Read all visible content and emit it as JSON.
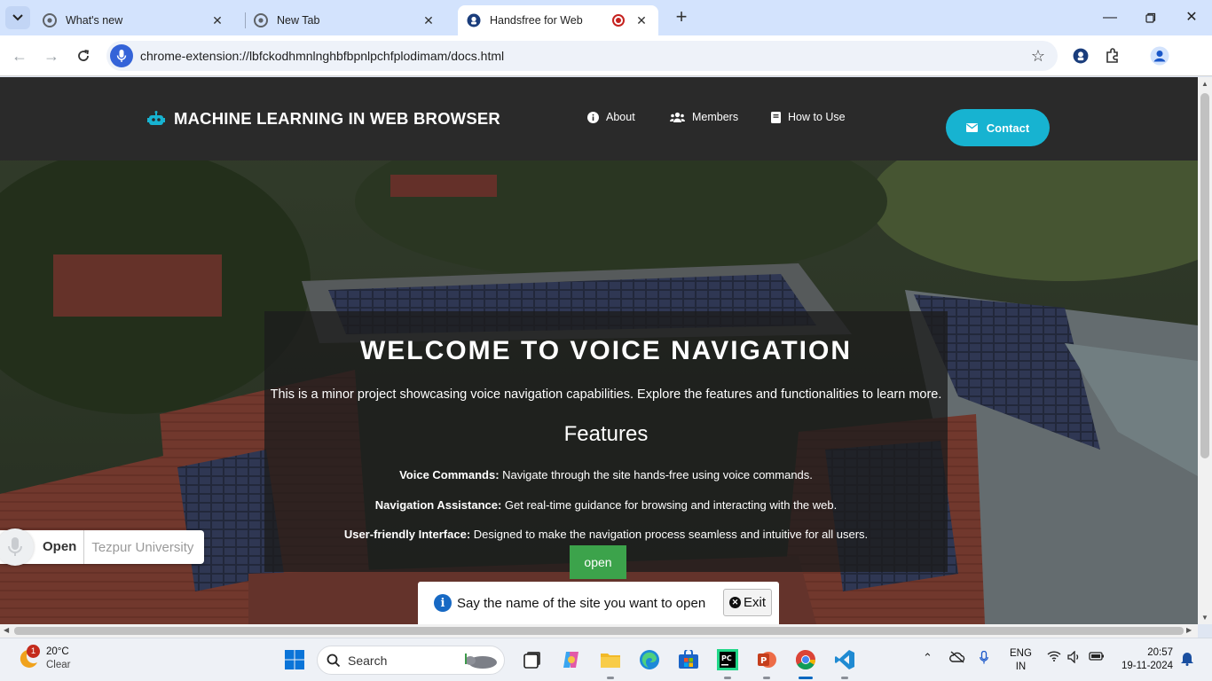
{
  "browser": {
    "tabs": [
      {
        "title": "What's new",
        "active": false
      },
      {
        "title": "New Tab",
        "active": false
      },
      {
        "title": "Handsfree for Web",
        "active": true
      }
    ],
    "url": "chrome-extension://lbfckodhmnlnghbfbpnlpchfplodimam/docs.html"
  },
  "site": {
    "brand": "MACHINE LEARNING IN WEB BROWSER",
    "nav": [
      {
        "label": "About",
        "icon": "info-icon"
      },
      {
        "label": "Members",
        "icon": "users-icon"
      },
      {
        "label": "How to Use",
        "icon": "book-icon"
      }
    ],
    "contact_label": "Contact",
    "hero": {
      "title": "WELCOME TO VOICE NAVIGATION",
      "description": "This is a minor project showcasing voice navigation capabilities. Explore the features and functionalities to learn more.",
      "features_heading": "Features",
      "features": [
        {
          "name": "Voice Commands:",
          "text": " Navigate through the site hands-free using voice commands."
        },
        {
          "name": "Navigation Assistance:",
          "text": " Get real-time guidance for browsing and interacting with the web."
        },
        {
          "name": "User-friendly Interface:",
          "text": " Designed to make the navigation process seamless and intuitive for all users."
        }
      ],
      "open_button": "open"
    }
  },
  "voice_widget": {
    "command": "Open",
    "query": "Tezpur University"
  },
  "voice_prompt": {
    "message": "Say the name of the site you want to open",
    "exit_label": "Exit"
  },
  "taskbar": {
    "weather": {
      "temp": "20°C",
      "condition": "Clear",
      "badge": "1"
    },
    "search_label": "Search",
    "language": {
      "line1": "ENG",
      "line2": "IN"
    },
    "time": "20:57",
    "date": "19-11-2024"
  },
  "colors": {
    "accent": "#17b3d1",
    "open_button": "#3ca34b",
    "nav_bg": "#2a2a2a",
    "tabstrip_bg": "#d3e3fd"
  }
}
